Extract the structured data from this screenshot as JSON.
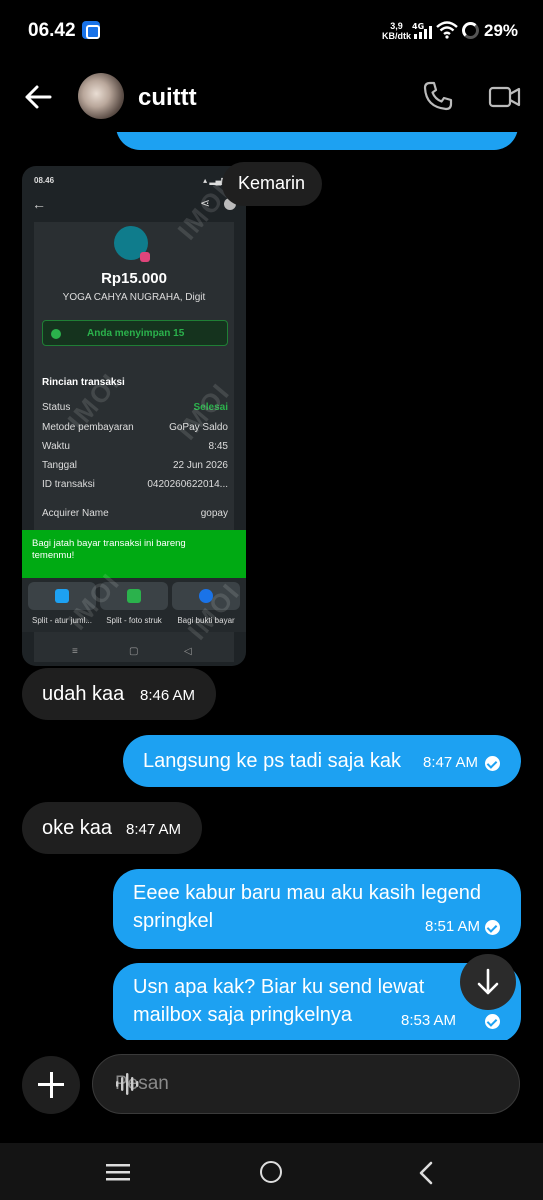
{
  "status_bar": {
    "time": "06.42",
    "speed_value": "3,9",
    "speed_unit": "KB/dtk",
    "network": "4G",
    "battery": "29%"
  },
  "header": {
    "contact_name": "cuittt"
  },
  "chat": {
    "date_chip": "Kemarin",
    "shared_image": {
      "status_time": "08.46",
      "amount": "Rp15.000",
      "merchant": "YOGA CAHYA NUGRAHA, Digit",
      "saved_text": "Anda menyimpan  15",
      "section_title": "Rincian transaksi",
      "rows": [
        {
          "key": "Status",
          "value": "Selesai"
        },
        {
          "key": "Metode pembayaran",
          "value": "GoPay Saldo"
        },
        {
          "key": "Waktu",
          "value": "8:45"
        },
        {
          "key": "Tanggal",
          "value": "22 Jun 2026"
        },
        {
          "key": "ID transaksi",
          "value": "0420260622014..."
        },
        {
          "key": "Acquirer Name",
          "value": "gopay"
        }
      ],
      "banner_text": "Bagi jatah bayar transaksi ini bareng temenmu!",
      "actions": [
        "Split - atur juml...",
        "Split - foto struk",
        "Bagi bukti bayar"
      ],
      "watermark": "IMOI"
    },
    "messages": [
      {
        "dir": "in",
        "text": "udah kaa",
        "time": "8:46 AM"
      },
      {
        "dir": "out",
        "text": "Langsung ke ps tadi saja kak",
        "time": "8:47 AM"
      },
      {
        "dir": "in",
        "text": "oke kaa",
        "time": "8:47 AM"
      },
      {
        "dir": "out",
        "line1": "Eeee kabur baru mau aku kasih legend",
        "line2": "springkel",
        "time": "8:51 AM"
      },
      {
        "dir": "out",
        "line1": "Usn apa kak? Biar ku send lewat",
        "line2": "mailbox saja pringkelnya",
        "time": "8:53 AM"
      }
    ]
  },
  "composer": {
    "placeholder": "Pesan"
  },
  "colors": {
    "outgoing_bubble": "#1da1f2",
    "incoming_bubble": "#1f1f1f",
    "background": "#000000"
  }
}
